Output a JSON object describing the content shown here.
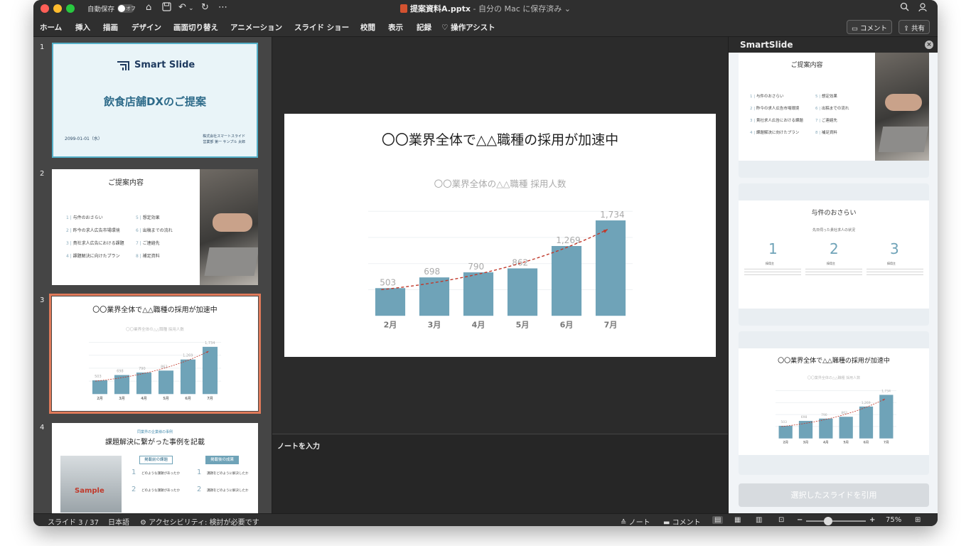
{
  "window": {
    "autosave_label": "自動保存",
    "autosave_state": "オフ",
    "title_file": "提案資料A.pptx",
    "title_suffix": " - 自分の Mac に保存済み ⌄"
  },
  "menu": {
    "items": [
      "ホーム",
      "挿入",
      "描画",
      "デザイン",
      "画面切り替え",
      "アニメーション",
      "スライド ショー",
      "校閲",
      "表示",
      "記録"
    ],
    "assist": "操作アシスト",
    "comment_button": "コメント",
    "share_button": "共有"
  },
  "thumbnails": {
    "numbers": [
      "1",
      "2",
      "3",
      "4"
    ],
    "slide1": {
      "brand": "Smart Slide",
      "title": "飲食店舗DXのご提案",
      "date": "2099-01-01（水）",
      "company": "株式会社スマートスライド",
      "person": "営業部 第一 サンプル 太郎"
    },
    "slide2": {
      "title": "ご提案内容",
      "items_left": [
        "与件のおさらい",
        "昨今の求人広告市場環境",
        "貴社求人広告における課題",
        "課題解決に向けたプラン"
      ],
      "items_right": [
        "想定効果",
        "出稿までの流れ",
        "ご連絡先",
        "補足資料"
      ]
    },
    "slide3": {
      "title": "〇〇業界全体で△△職種の採用が加速中",
      "chart_title": "〇〇業界全体の△△職種 採用人数"
    },
    "slide4": {
      "kicker": "同業界の企業様の事例",
      "title": "課題解決に繋がった事例を記載",
      "before_label": "掲載前の課題",
      "after_label": "掲載後の成果",
      "photo_text": "Sample",
      "q1": "どのような課題があったか",
      "a1": "課題をどのように解決したか"
    }
  },
  "slide": {
    "title": "〇〇業界全体で△△職種の採用が加速中",
    "chart_title": "〇〇業界全体の△△職種 採用人数"
  },
  "chart_data": {
    "type": "bar",
    "title": "〇〇業界全体の△△職種 採用人数",
    "categories": [
      "2月",
      "3月",
      "4月",
      "5月",
      "6月",
      "7月"
    ],
    "values": [
      503,
      698,
      790,
      862,
      1269,
      1734
    ],
    "value_labels": [
      "503",
      "698",
      "790",
      "862",
      "1,269",
      "1,734"
    ],
    "ylim": [
      0,
      1900
    ],
    "bar_color": "#6fa3b8",
    "trend_color": "#c0392b",
    "grid": true,
    "xlabel": "",
    "ylabel": ""
  },
  "notes": {
    "placeholder": "ノートを入力"
  },
  "smartslide": {
    "header": "SmartSlide",
    "card2": {
      "title": "与件のおさらい",
      "subtitle": "先日伺った貴社求人の状況",
      "numbers": [
        "1",
        "2",
        "3"
      ],
      "labels": [
        "採用主",
        "採用主",
        "採用主"
      ]
    },
    "quote_button": "選択したスライドを引用"
  },
  "status": {
    "slide_indicator": "スライド 3 / 37",
    "language": "日本語",
    "accessibility": "アクセシビリティ: 検討が必要です",
    "notes_btn": "ノート",
    "comments_btn": "コメント",
    "zoom": "75%"
  },
  "colors": {
    "accent": "#e07a5a",
    "bar": "#6fa3b8",
    "titlebar": "#2f2f2f",
    "thumb_panel": "#454545"
  }
}
